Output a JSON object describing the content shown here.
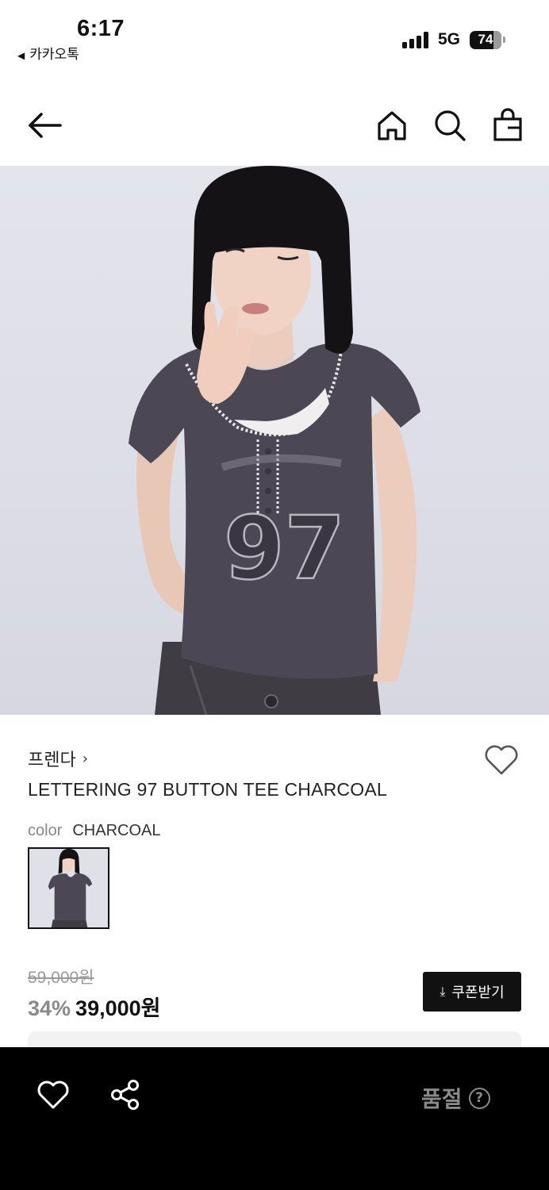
{
  "status_bar": {
    "time": "6:17",
    "back_app": "카카오톡",
    "network": "5G",
    "battery": "74"
  },
  "nav": {
    "icons": [
      "back-arrow-icon",
      "home-icon",
      "search-icon",
      "shopping-bag-icon"
    ]
  },
  "product": {
    "brand": "프렌다",
    "brand_chevron": "›",
    "title": "LETTERING 97 BUTTON TEE CHARCOAL",
    "color_label": "color",
    "color_value": "CHARCOAL",
    "original_price": "59,000원",
    "discount_rate": "34%",
    "sale_price": "39,000원",
    "coupon_label": "쿠폰받기",
    "shirt_print": "97"
  },
  "bottom_bar": {
    "sold_out_label": "품절",
    "help_glyph": "?"
  },
  "colors": {
    "shirt": "#4a4652",
    "background": "#dfe0e8",
    "button_dark": "#111111",
    "muted_text": "#8a8a8a"
  }
}
